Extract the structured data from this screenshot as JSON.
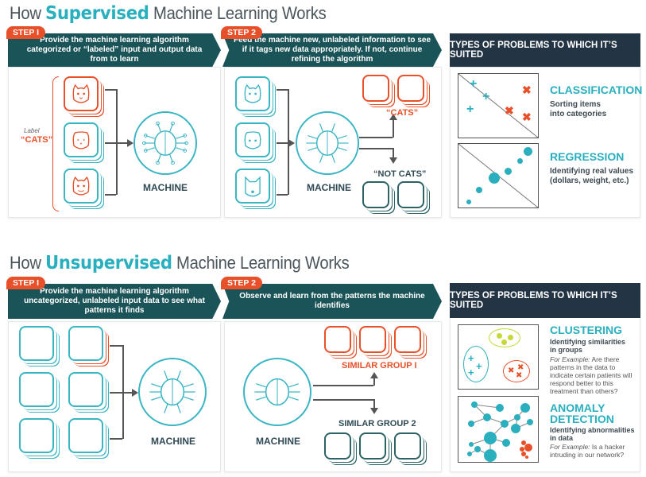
{
  "supervised": {
    "title_pre": "How ",
    "title_hl": "Supervised",
    "title_post": " Machine Learning Works",
    "step1": {
      "label": "STEP I",
      "text": "Provide the machine learning algorithm categorized or “labeled” input and output data from to learn"
    },
    "step2": {
      "label": "STEP 2",
      "text": "Feed the machine new, unlabeled information to see if it tags new data appropriately. If not, continue refining the algorithm"
    },
    "label_small": "Label",
    "label_cats": "“CATS”",
    "machine": "MACHINE",
    "machine2": "MACHINE",
    "cats_out": "“CATS”",
    "not_cats_out": "“NOT CATS”",
    "types_header": "TYPES OF PROBLEMS TO WHICH IT’S SUITED",
    "problems": [
      {
        "title": "CLASSIFICATION",
        "desc": "Sorting items into categories"
      },
      {
        "title": "REGRESSION",
        "desc": "Identifying real values (dollars, weight, etc.)"
      }
    ]
  },
  "unsupervised": {
    "title_pre": "How ",
    "title_hl": "Unsupervised",
    "title_post": " Machine Learning Works",
    "step1": {
      "label": "STEP I",
      "text": "Provide the machine learning algorithm uncategorized, unlabeled input data to see what patterns it finds"
    },
    "step2": {
      "label": "STEP 2",
      "text": "Observe and learn from the patterns the machine identifies"
    },
    "machine": "MACHINE",
    "machine2": "MACHINE",
    "group1": "SIMILAR GROUP I",
    "group2": "SIMILAR GROUP 2",
    "types_header": "TYPES OF PROBLEMS TO WHICH IT’S SUITED",
    "problems": [
      {
        "title": "CLUSTERING",
        "desc": "Identifying similarities in groups",
        "example_label": "For Example:",
        "example": " Are there patterns in the data to indicate certain patients will respond better to this treatment than others?"
      },
      {
        "title": "ANOMALY DETECTION",
        "desc": "Identifying abnormalities in data",
        "example_label": "For Example:",
        "example": " Is a hacker intruding in our network?"
      }
    ]
  },
  "colors": {
    "teal": "#2aafbf",
    "orange": "#e8502a",
    "dark_teal": "#1b5458",
    "navy": "#233444"
  }
}
